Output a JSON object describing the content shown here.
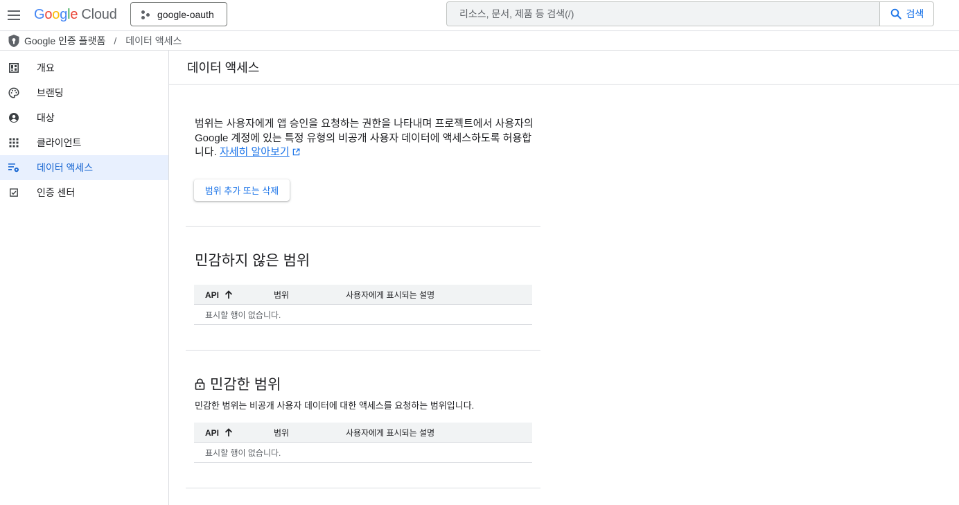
{
  "header": {
    "logo": {
      "g": "G",
      "o1": "o",
      "o2": "o",
      "g2": "g",
      "l": "l",
      "e": "e",
      "cloud": "Cloud"
    },
    "project": "google-oauth",
    "search_placeholder": "리소스, 문서, 제품 등 검색(/)",
    "search_button": "검색"
  },
  "breadcrumb": {
    "product": "Google 인증 플랫폼",
    "separator": "/",
    "current": "데이터 액세스"
  },
  "sidebar": {
    "items": [
      {
        "label": "개요",
        "icon": "dashboard-icon"
      },
      {
        "label": "브랜딩",
        "icon": "palette-icon"
      },
      {
        "label": "대상",
        "icon": "person-icon"
      },
      {
        "label": "클라이언트",
        "icon": "apps-grid-icon"
      },
      {
        "label": "데이터 액세스",
        "icon": "data-access-icon",
        "active": true
      },
      {
        "label": "인증 센터",
        "icon": "checkbox-icon"
      }
    ]
  },
  "main": {
    "title": "데이터 액세스",
    "intro_text": "범위는 사용자에게 앱 승인을 요청하는 권한을 나타내며 프로젝트에서 사용자의 Google 계정에 있는 특정 유형의 비공개 사용자 데이터에 액세스하도록 허용합니다. ",
    "learn_more": "자세히 알아보기",
    "add_scope_button": "범위 추가 또는 삭제",
    "non_sensitive": {
      "title": "민감하지 않은 범위",
      "columns": [
        "API",
        "범위",
        "사용자에게 표시되는 설명"
      ],
      "empty": "표시할 행이 없습니다."
    },
    "sensitive": {
      "title": "민감한 범위",
      "description": "민감한 범위는 비공개 사용자 데이터에 대한 액세스를 요청하는 범위입니다.",
      "columns": [
        "API",
        "범위",
        "사용자에게 표시되는 설명"
      ],
      "empty": "표시할 행이 없습니다."
    }
  },
  "colors": {
    "accent": "#1a73e8",
    "active_bg": "#e8f0fe",
    "divider": "#dadce0"
  }
}
